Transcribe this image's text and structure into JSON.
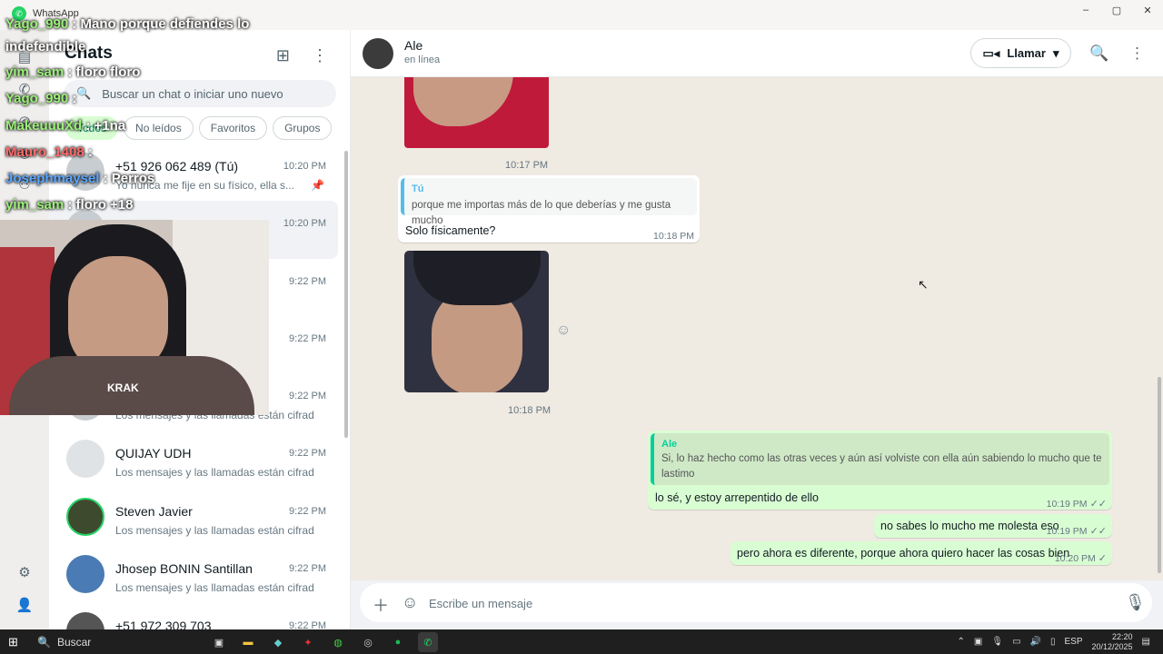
{
  "window": {
    "title": "WhatsApp",
    "minimize": "–",
    "maximize": "▢",
    "close": "✕"
  },
  "sidebar": {
    "title": "Chats",
    "search_placeholder": "Buscar un chat o iniciar uno nuevo",
    "filters": [
      "Todos",
      "No leídos",
      "Favoritos",
      "Grupos"
    ],
    "chats": [
      {
        "name": "+51 926 062 489 (Tú)",
        "time": "10:20 PM",
        "preview": "Yo nunca me fije en su físico, ella s...",
        "pinned": true
      },
      {
        "name": "",
        "time": "10:20 PM",
        "preview": "ue ahora ..."
      },
      {
        "name": "",
        "time": "9:22 PM",
        "preview": "án cifrad..."
      },
      {
        "name": "",
        "time": "9:22 PM",
        "preview": "án cifrad..."
      },
      {
        "name": "",
        "time": "9:22 PM",
        "preview": "Los mensajes y las llamadas están cifrad..."
      },
      {
        "name": "QUIJAY UDH",
        "time": "9:22 PM",
        "preview": "Los mensajes y las llamadas están cifrad..."
      },
      {
        "name": "Steven Javier",
        "time": "9:22 PM",
        "preview": "Los mensajes y las llamadas están cifrad..."
      },
      {
        "name": "Jhosep BONIN Santillan",
        "time": "9:22 PM",
        "preview": "Los mensajes y las llamadas están cifrad..."
      },
      {
        "name": "+51 972 309 703",
        "time": "9:22 PM",
        "preview": ""
      }
    ]
  },
  "header": {
    "name": "Ale",
    "status": "en línea",
    "call_label": "Llamar"
  },
  "messages": {
    "t1": "10:17 PM",
    "reply1": {
      "quote_name": "Tú",
      "quote_text": "porque me importas más de lo que deberías y me gusta mucho",
      "text": "Solo físicamente?",
      "time": "10:18 PM"
    },
    "t2": "10:18 PM",
    "reply2": {
      "quote_name": "Ale",
      "quote_line1": "Si, lo haz hecho como las otras veces y aún así volviste con ella aún sabiendo lo mucho que te",
      "quote_line2": "lastimo",
      "text": "lo sé, y estoy arrepentido de ello",
      "time": "10:19 PM"
    },
    "m3": {
      "text": "no sabes lo mucho me molesta eso",
      "time": "10:19 PM"
    },
    "m4": {
      "text": "pero ahora es diferente, porque ahora quiero hacer las cosas bien",
      "time": "10:20 PM"
    }
  },
  "composer": {
    "placeholder": "Escribe un mensaje"
  },
  "taskbar": {
    "search": "Buscar",
    "lang": "ESP",
    "time": "22:20",
    "date": "20/12/2025"
  },
  "stream_chat": [
    {
      "user": "Yago_990",
      "msg": ": Mano porque defiendes lo"
    },
    {
      "user": "",
      "msg": "indefendible"
    },
    {
      "user": "yim_sam",
      "msg": ": floro floro"
    },
    {
      "user": "Yago_990",
      "msg": ":"
    },
    {
      "user": "MakeuuuXd",
      "msg": ": +1na"
    },
    {
      "user": "Mauro_1408",
      "msg": ":"
    },
    {
      "user": "Josephmaysel",
      "msg": ": Perros"
    },
    {
      "user": "yim_sam",
      "msg": ": floro +18"
    }
  ],
  "webcam_logo": "KRAK"
}
